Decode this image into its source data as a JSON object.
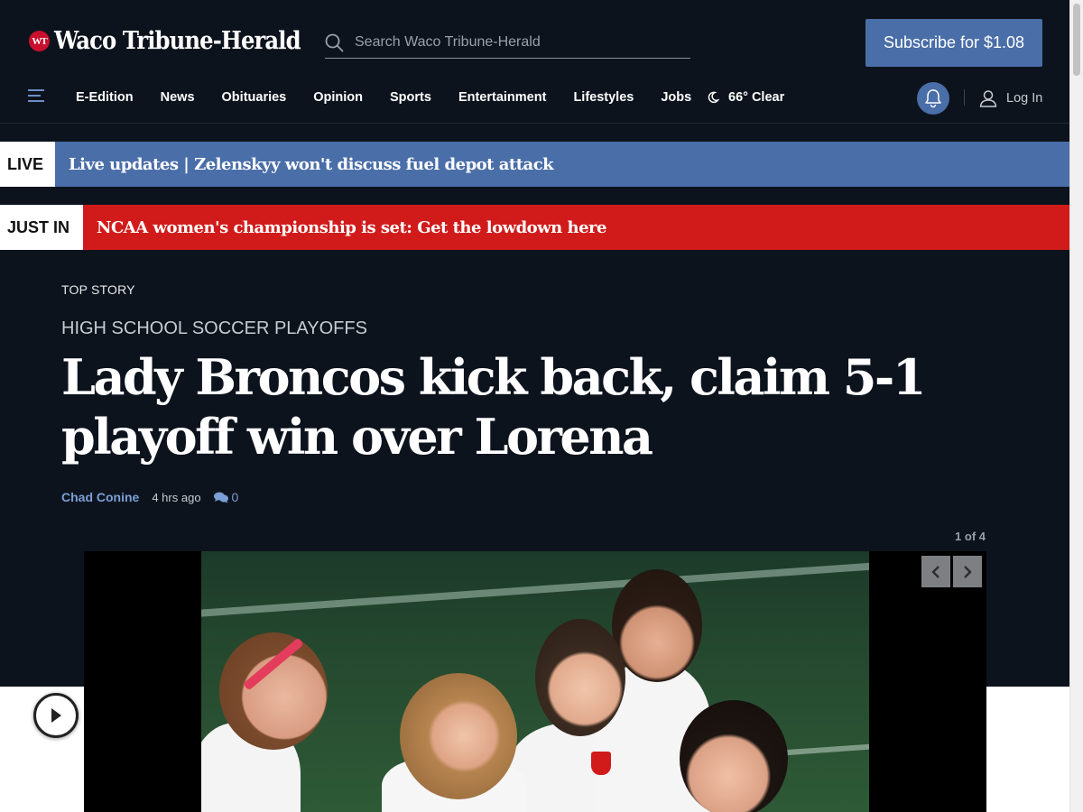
{
  "header": {
    "logo_badge": "WT",
    "logo_text": "Waco Tribune-Herald",
    "search_placeholder": "Search Waco Tribune-Herald",
    "subscribe_label": "Subscribe for $1.08"
  },
  "nav": {
    "items": [
      "E-Edition",
      "News",
      "Obituaries",
      "Opinion",
      "Sports",
      "Entertainment",
      "Lifestyles",
      "Jobs"
    ],
    "weather": "66° Clear",
    "login_label": "Log In"
  },
  "alerts": {
    "live_tag": "LIVE",
    "live_headline": "Live updates | Zelenskyy won't discuss fuel depot attack",
    "justin_tag": "JUST IN",
    "justin_headline": "NCAA women's championship is set: Get the lowdown here"
  },
  "story": {
    "section": "TOP STORY",
    "kicker": "HIGH SCHOOL SOCCER PLAYOFFS",
    "title": "Lady Broncos kick back, claim 5-1 playoff win over Lorena",
    "author": "Chad Conine",
    "time": "4 hrs ago",
    "comments": "0"
  },
  "gallery": {
    "counter": "1 of 4"
  },
  "colors": {
    "background": "#0d131d",
    "accent": "#4a6ea8",
    "breaking_red": "#d11b1b",
    "link": "#7b9fd6"
  }
}
